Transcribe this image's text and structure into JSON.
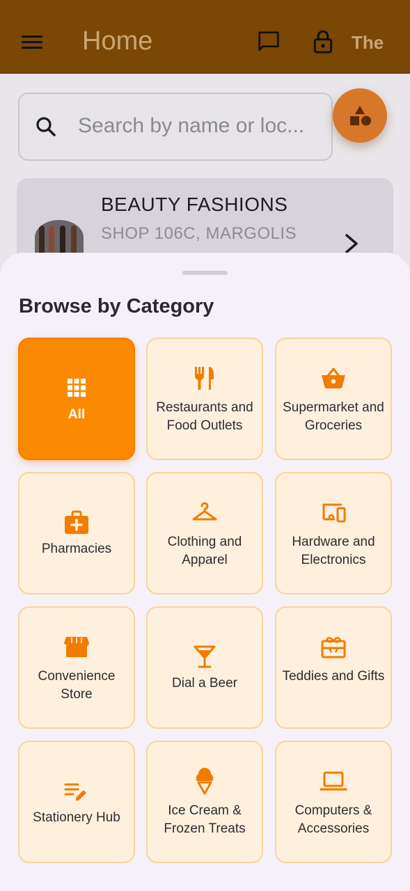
{
  "appbar": {
    "title": "Home",
    "user": "The"
  },
  "search": {
    "placeholder": "Search by name or loc..."
  },
  "store_card": {
    "name": "BEAUTY FASHIONS",
    "address": "SHOP 106C, MARGOLIS"
  },
  "sheet": {
    "title": "Browse by Category",
    "categories": [
      {
        "label": "All",
        "icon": "apps-grid-icon",
        "active": true
      },
      {
        "label": "Restaurants and Food Outlets",
        "icon": "restaurant-icon"
      },
      {
        "label": "Supermarket and Groceries",
        "icon": "shopping-basket-icon"
      },
      {
        "label": "Pharmacies",
        "icon": "medical-bag-icon"
      },
      {
        "label": "Clothing and Apparel",
        "icon": "hanger-icon"
      },
      {
        "label": "Hardware and Electronics",
        "icon": "devices-icon"
      },
      {
        "label": "Convenience Store",
        "icon": "storefront-icon"
      },
      {
        "label": "Dial a Beer",
        "icon": "cocktail-glass-icon"
      },
      {
        "label": "Teddies and Gifts",
        "icon": "gift-card-icon"
      },
      {
        "label": "Stationery Hub",
        "icon": "edit-note-icon"
      },
      {
        "label": "Ice Cream & Frozen Treats",
        "icon": "ice-cream-icon"
      },
      {
        "label": "Computers & Accessories",
        "icon": "laptop-icon"
      }
    ]
  },
  "colors": {
    "appbar_bg": "#7a4705",
    "accent": "#fb8a00",
    "tile_bg": "#fff0dd",
    "tile_border": "#f8d49c",
    "icon_orange": "#f07c00"
  }
}
